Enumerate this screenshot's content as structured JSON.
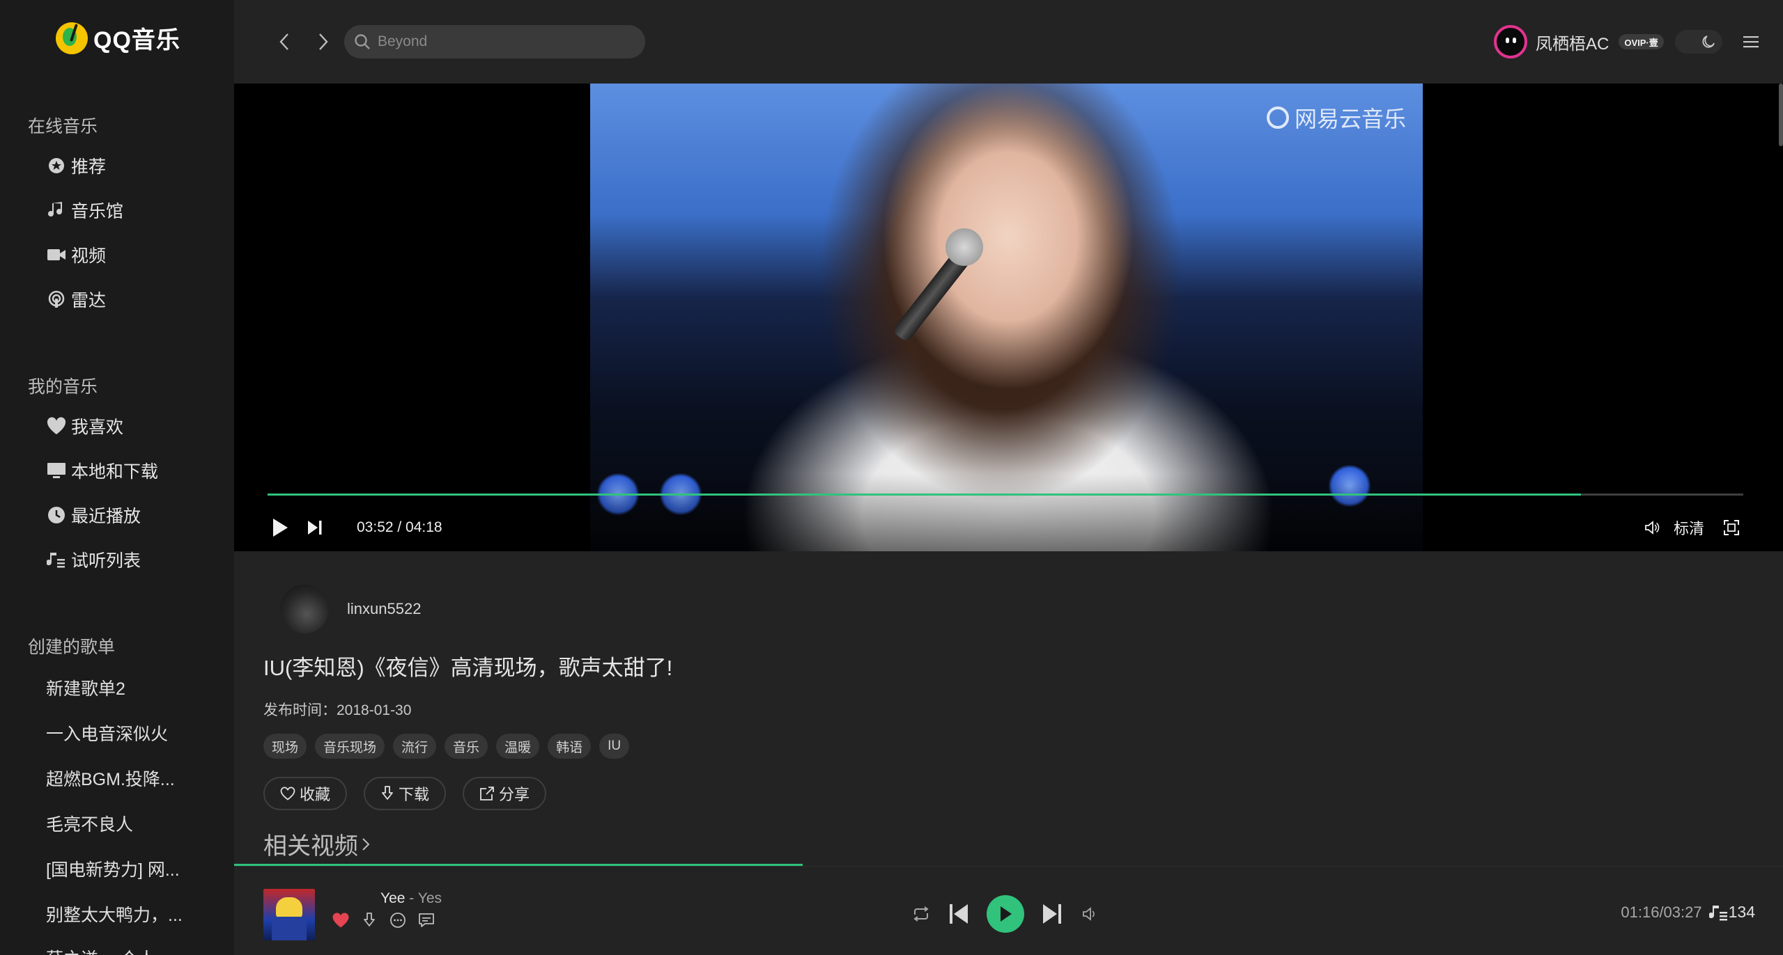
{
  "app": {
    "name": "QQ音乐"
  },
  "sidebar": {
    "sections": [
      {
        "title": "在线音乐",
        "items": [
          {
            "label": "推荐",
            "icon": "recommend-icon"
          },
          {
            "label": "音乐馆",
            "icon": "music-note-icon"
          },
          {
            "label": "视频",
            "icon": "video-camera-icon"
          },
          {
            "label": "雷达",
            "icon": "radar-icon"
          }
        ]
      },
      {
        "title": "我的音乐",
        "items": [
          {
            "label": "我喜欢",
            "icon": "heart-icon"
          },
          {
            "label": "本地和下载",
            "icon": "monitor-icon"
          },
          {
            "label": "最近播放",
            "icon": "clock-icon"
          },
          {
            "label": "试听列表",
            "icon": "playlist-icon"
          }
        ]
      },
      {
        "title": "创建的歌单",
        "items": [
          {
            "label": "新建歌单2"
          },
          {
            "label": "一入电音深似火"
          },
          {
            "label": "超燃BGM.投降..."
          },
          {
            "label": "毛亮不良人"
          },
          {
            "label": "[国电新势力] 网..."
          },
          {
            "label": "别整太大鸭力，..."
          },
          {
            "label": "薛之谦 一个人..."
          }
        ]
      }
    ]
  },
  "header": {
    "search_placeholder": "Beyond",
    "username": "凤栖梧AC",
    "vip_badge": "OVIP·壹"
  },
  "video": {
    "watermark": "网易云音乐",
    "current_time": "03:52",
    "duration": "04:18",
    "time_display": "03:52 / 04:18",
    "progress": 0.89,
    "quality": "标清"
  },
  "info": {
    "uploader": "linxun5522",
    "title": "IU(李知恩)《夜信》高清现场，歌声太甜了!",
    "publish_label": "发布时间：2018-01-30",
    "tags": [
      "现场",
      "音乐现场",
      "流行",
      "音乐",
      "温暖",
      "韩语",
      "IU"
    ],
    "actions": {
      "favorite": "收藏",
      "download": "下载",
      "share": "分享"
    },
    "related_title": "相关视频"
  },
  "player": {
    "song": "Yee",
    "separator": " - ",
    "artist": "Yes",
    "time": "01:16/03:27",
    "queue_count": "134"
  },
  "colors": {
    "accent": "#31c27c",
    "heart": "#e64452",
    "avatar_ring": "#e0338f",
    "logo_yellow": "#f5c400"
  }
}
